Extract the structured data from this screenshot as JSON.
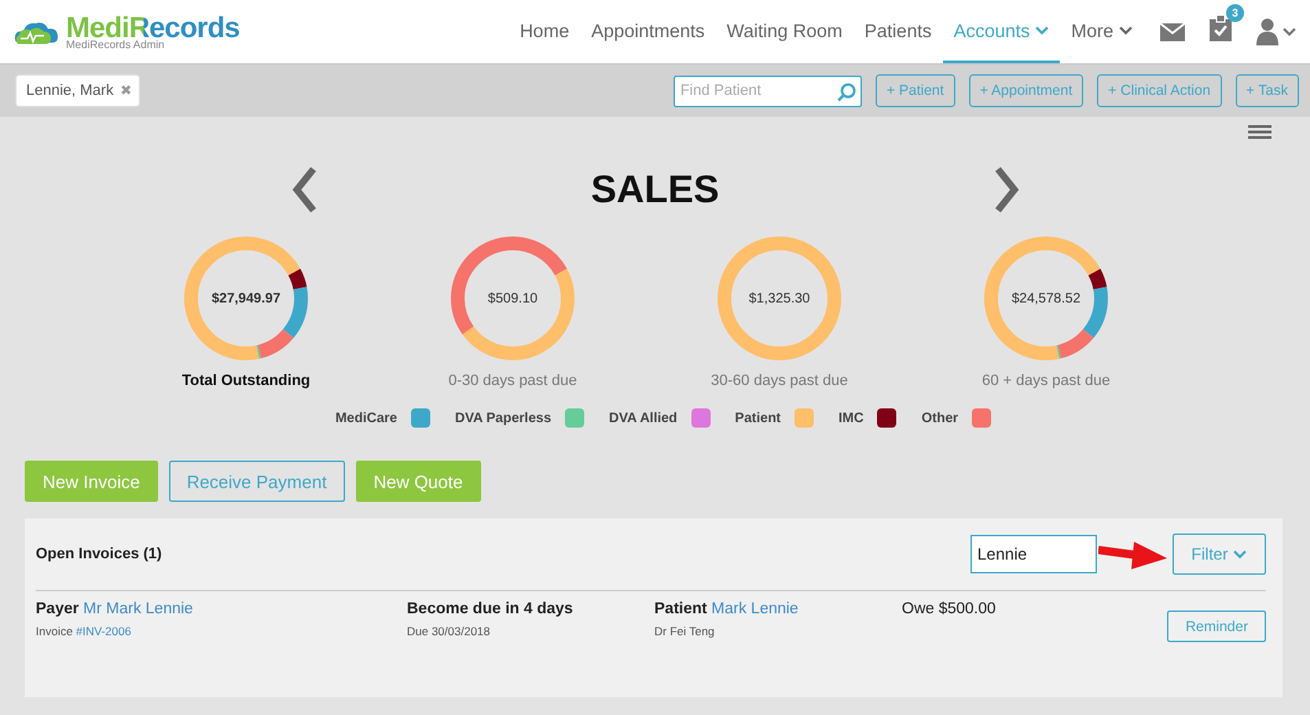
{
  "logo": {
    "name": "MediRecords",
    "subtitle": "MediRecords Admin"
  },
  "nav": [
    {
      "label": "Home",
      "selected": false,
      "dropdown": false
    },
    {
      "label": "Appointments",
      "selected": false,
      "dropdown": false
    },
    {
      "label": "Waiting Room",
      "selected": false,
      "dropdown": false
    },
    {
      "label": "Patients",
      "selected": false,
      "dropdown": false
    },
    {
      "label": "Accounts",
      "selected": true,
      "dropdown": true
    },
    {
      "label": "More",
      "selected": false,
      "dropdown": true
    }
  ],
  "tasks_badge": "3",
  "patient_tab": {
    "label": "Lennie, Mark",
    "close": "✖"
  },
  "find_patient": {
    "placeholder": "Find Patient"
  },
  "quick_actions": [
    "+ Patient",
    "+ Appointment",
    "+ Clinical Action",
    "+ Task"
  ],
  "sales": {
    "title": "SALES",
    "donuts": [
      {
        "amount": "$27,949.97",
        "label": "Total Outstanding",
        "kind": "total"
      },
      {
        "amount": "$509.10",
        "label": "0-30 days past due",
        "kind": "bucket"
      },
      {
        "amount": "$1,325.30",
        "label": "30-60 days past due",
        "kind": "bucket"
      },
      {
        "amount": "$24,578.52",
        "label": "60 + days past due",
        "kind": "bucket"
      }
    ],
    "legend": [
      {
        "label": "MediCare",
        "color": "#3ea8c9"
      },
      {
        "label": "DVA Paperless",
        "color": "#66cc99"
      },
      {
        "label": "DVA Allied",
        "color": "#dd77dd"
      },
      {
        "label": "Patient",
        "color": "#ffbe6a"
      },
      {
        "label": "IMC",
        "color": "#800016"
      },
      {
        "label": "Other",
        "color": "#f5736a"
      }
    ]
  },
  "actions": [
    {
      "label": "New Invoice",
      "kind": "primary"
    },
    {
      "label": "Receive Payment",
      "kind": "outline"
    },
    {
      "label": "New Quote",
      "kind": "primary"
    }
  ],
  "invoices": {
    "title": "Open Invoices (1)",
    "search_value": "Lennie",
    "filter": "Filter",
    "rows": [
      {
        "payer_label": "Payer",
        "payer": "Mr Mark Lennie",
        "invoice_label": "Invoice",
        "invoice": "#INV-2006",
        "due_title": "Become due in 4 days",
        "due_date": "Due 30/03/2018",
        "patient_label": "Patient",
        "patient": "Mark Lennie",
        "doctor": "Dr Fei Teng",
        "owe": "Owe $500.00",
        "button": "Reminder"
      }
    ]
  }
}
